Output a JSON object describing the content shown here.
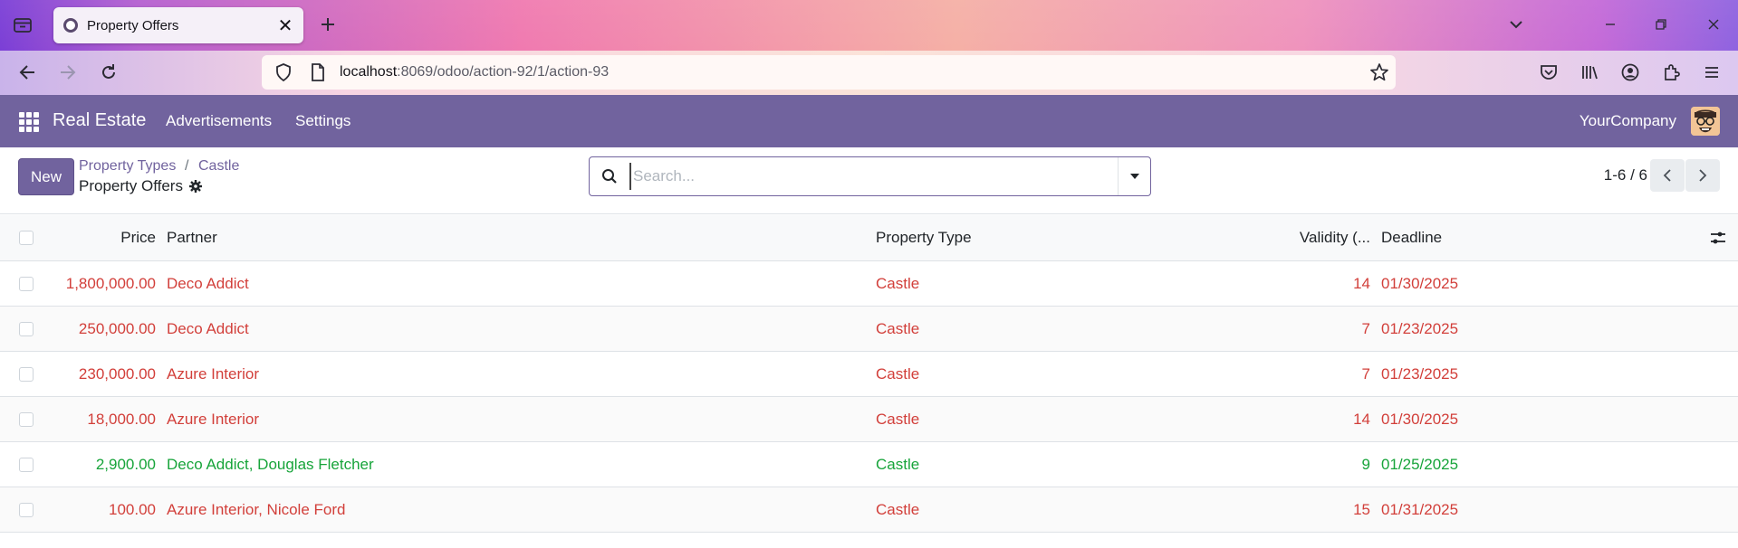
{
  "browser": {
    "tab_title": "Property Offers",
    "url_host": "localhost",
    "url_rest": ":8069/odoo/action-92/1/action-93"
  },
  "app": {
    "brand": "Real Estate",
    "menu": [
      "Advertisements",
      "Settings"
    ],
    "company": "YourCompany"
  },
  "control_panel": {
    "new_label": "New",
    "breadcrumbs": [
      "Property Types",
      "Castle"
    ],
    "breadcrumb_sep": "/",
    "current": "Property Offers",
    "search_placeholder": "Search...",
    "pager": "1-6 / 6"
  },
  "table": {
    "columns": [
      "Price",
      "Partner",
      "Property Type",
      "Validity (...",
      "Deadline"
    ],
    "rows": [
      {
        "price": "1,800,000.00",
        "partner": "Deco Addict",
        "type": "Castle",
        "validity": "14",
        "deadline": "01/30/2025",
        "status": "refused"
      },
      {
        "price": "250,000.00",
        "partner": "Deco Addict",
        "type": "Castle",
        "validity": "7",
        "deadline": "01/23/2025",
        "status": "refused"
      },
      {
        "price": "230,000.00",
        "partner": "Azure Interior",
        "type": "Castle",
        "validity": "7",
        "deadline": "01/23/2025",
        "status": "refused"
      },
      {
        "price": "18,000.00",
        "partner": "Azure Interior",
        "type": "Castle",
        "validity": "14",
        "deadline": "01/30/2025",
        "status": "refused"
      },
      {
        "price": "2,900.00",
        "partner": "Deco Addict, Douglas Fletcher",
        "type": "Castle",
        "validity": "9",
        "deadline": "01/25/2025",
        "status": "accepted"
      },
      {
        "price": "100.00",
        "partner": "Azure Interior, Nicole Ford",
        "type": "Castle",
        "validity": "15",
        "deadline": "01/31/2025",
        "status": "refused"
      }
    ]
  },
  "colors": {
    "brand_purple": "#71639e",
    "refused": "#d23f3a",
    "accepted": "#17a43a"
  },
  "icons": [
    "tab-list-icon",
    "close-icon",
    "plus-icon",
    "chevron-down-icon",
    "minimize-icon",
    "restore-icon",
    "window-close-icon",
    "back-icon",
    "forward-icon",
    "reload-icon",
    "shield-icon",
    "page-icon",
    "star-icon",
    "pocket-icon",
    "library-icon",
    "account-icon",
    "extensions-icon",
    "menu-icon",
    "apps-grid-icon",
    "avatar",
    "gear-icon",
    "search-icon",
    "caret-down-icon",
    "chevron-left-icon",
    "chevron-right-icon",
    "optional-columns-icon"
  ]
}
